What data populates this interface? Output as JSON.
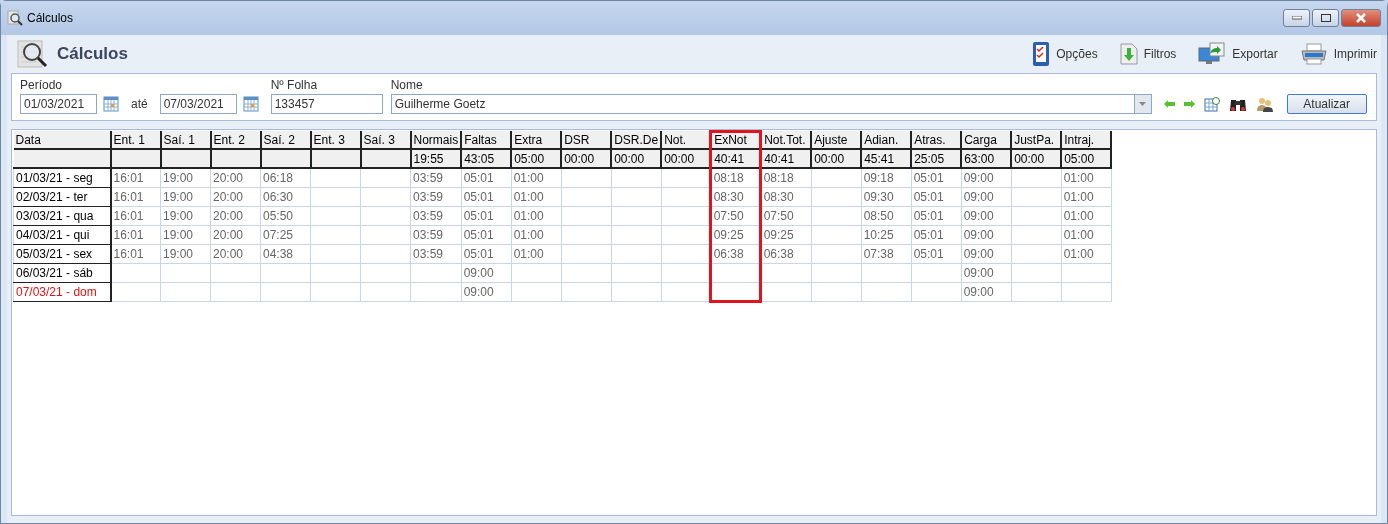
{
  "window": {
    "title": "Cálculos"
  },
  "header": {
    "title": "Cálculos"
  },
  "toolbar": [
    {
      "label": "Opções",
      "kind": "options"
    },
    {
      "label": "Filtros",
      "kind": "filters"
    },
    {
      "label": "Exportar",
      "kind": "export"
    },
    {
      "label": "Imprimir",
      "kind": "print"
    }
  ],
  "filters": {
    "period_label": "Período",
    "start_date": "01/03/2021",
    "to_label": "até",
    "end_date": "07/03/2021",
    "sheet_label": "Nº Folha",
    "sheet": "133457",
    "name_label": "Nome",
    "name": "Guilherme Goetz",
    "refresh_button": "Atualizar"
  },
  "table": {
    "columns": [
      {
        "label": "Data",
        "highlighted": false
      },
      {
        "label": "Ent. 1",
        "highlighted": false
      },
      {
        "label": "Saí. 1",
        "highlighted": false
      },
      {
        "label": "Ent. 2",
        "highlighted": false
      },
      {
        "label": "Saí. 2",
        "highlighted": false
      },
      {
        "label": "Ent. 3",
        "highlighted": false
      },
      {
        "label": "Saí. 3",
        "highlighted": false
      },
      {
        "label": "Normais",
        "highlighted": false
      },
      {
        "label": "Faltas",
        "highlighted": false
      },
      {
        "label": "Extra",
        "highlighted": false
      },
      {
        "label": "DSR",
        "highlighted": false
      },
      {
        "label": "DSR.De",
        "highlighted": false
      },
      {
        "label": "Not.",
        "highlighted": false
      },
      {
        "label": "ExNot",
        "highlighted": true
      },
      {
        "label": "Not.Tot.",
        "highlighted": false
      },
      {
        "label": "Ajuste",
        "highlighted": false
      },
      {
        "label": "Adian.",
        "highlighted": false
      },
      {
        "label": "Atras.",
        "highlighted": false
      },
      {
        "label": "Carga",
        "highlighted": false
      },
      {
        "label": "JustPa.",
        "highlighted": false
      },
      {
        "label": "Intraj.",
        "highlighted": false
      }
    ],
    "totals": [
      "19:55",
      "43:05",
      "05:00",
      "00:00",
      "00:00",
      "00:00",
      "40:41",
      "40:41",
      "00:00",
      "45:41",
      "25:05",
      "63:00",
      "00:00",
      "05:00"
    ],
    "rows": [
      {
        "flagged": false,
        "cells": [
          "01/03/21 - seg",
          "16:01",
          "19:00",
          "20:00",
          "06:18",
          "",
          "",
          "03:59",
          "05:01",
          "01:00",
          "",
          "",
          "",
          "08:18",
          "08:18",
          "",
          "09:18",
          "05:01",
          "09:00",
          "",
          "01:00"
        ]
      },
      {
        "flagged": false,
        "cells": [
          "02/03/21 - ter",
          "16:01",
          "19:00",
          "20:00",
          "06:30",
          "",
          "",
          "03:59",
          "05:01",
          "01:00",
          "",
          "",
          "",
          "08:30",
          "08:30",
          "",
          "09:30",
          "05:01",
          "09:00",
          "",
          "01:00"
        ]
      },
      {
        "flagged": false,
        "cells": [
          "03/03/21 - qua",
          "16:01",
          "19:00",
          "20:00",
          "05:50",
          "",
          "",
          "03:59",
          "05:01",
          "01:00",
          "",
          "",
          "",
          "07:50",
          "07:50",
          "",
          "08:50",
          "05:01",
          "09:00",
          "",
          "01:00"
        ]
      },
      {
        "flagged": false,
        "cells": [
          "04/03/21 - qui",
          "16:01",
          "19:00",
          "20:00",
          "07:25",
          "",
          "",
          "03:59",
          "05:01",
          "01:00",
          "",
          "",
          "",
          "09:25",
          "09:25",
          "",
          "10:25",
          "05:01",
          "09:00",
          "",
          "01:00"
        ]
      },
      {
        "flagged": false,
        "cells": [
          "05/03/21 - sex",
          "16:01",
          "19:00",
          "20:00",
          "04:38",
          "",
          "",
          "03:59",
          "05:01",
          "01:00",
          "",
          "",
          "",
          "06:38",
          "06:38",
          "",
          "07:38",
          "05:01",
          "09:00",
          "",
          "01:00"
        ]
      },
      {
        "flagged": false,
        "cells": [
          "06/03/21 - sáb",
          "",
          "",
          "",
          "",
          "",
          "",
          "",
          "09:00",
          "",
          "",
          "",
          "",
          "",
          "",
          "",
          "",
          "",
          "09:00",
          "",
          ""
        ]
      },
      {
        "flagged": true,
        "cells": [
          "07/03/21 - dom",
          "",
          "",
          "",
          "",
          "",
          "",
          "",
          "09:00",
          "",
          "",
          "",
          "",
          "",
          "",
          "",
          "",
          "",
          "09:00",
          "",
          ""
        ]
      }
    ]
  }
}
